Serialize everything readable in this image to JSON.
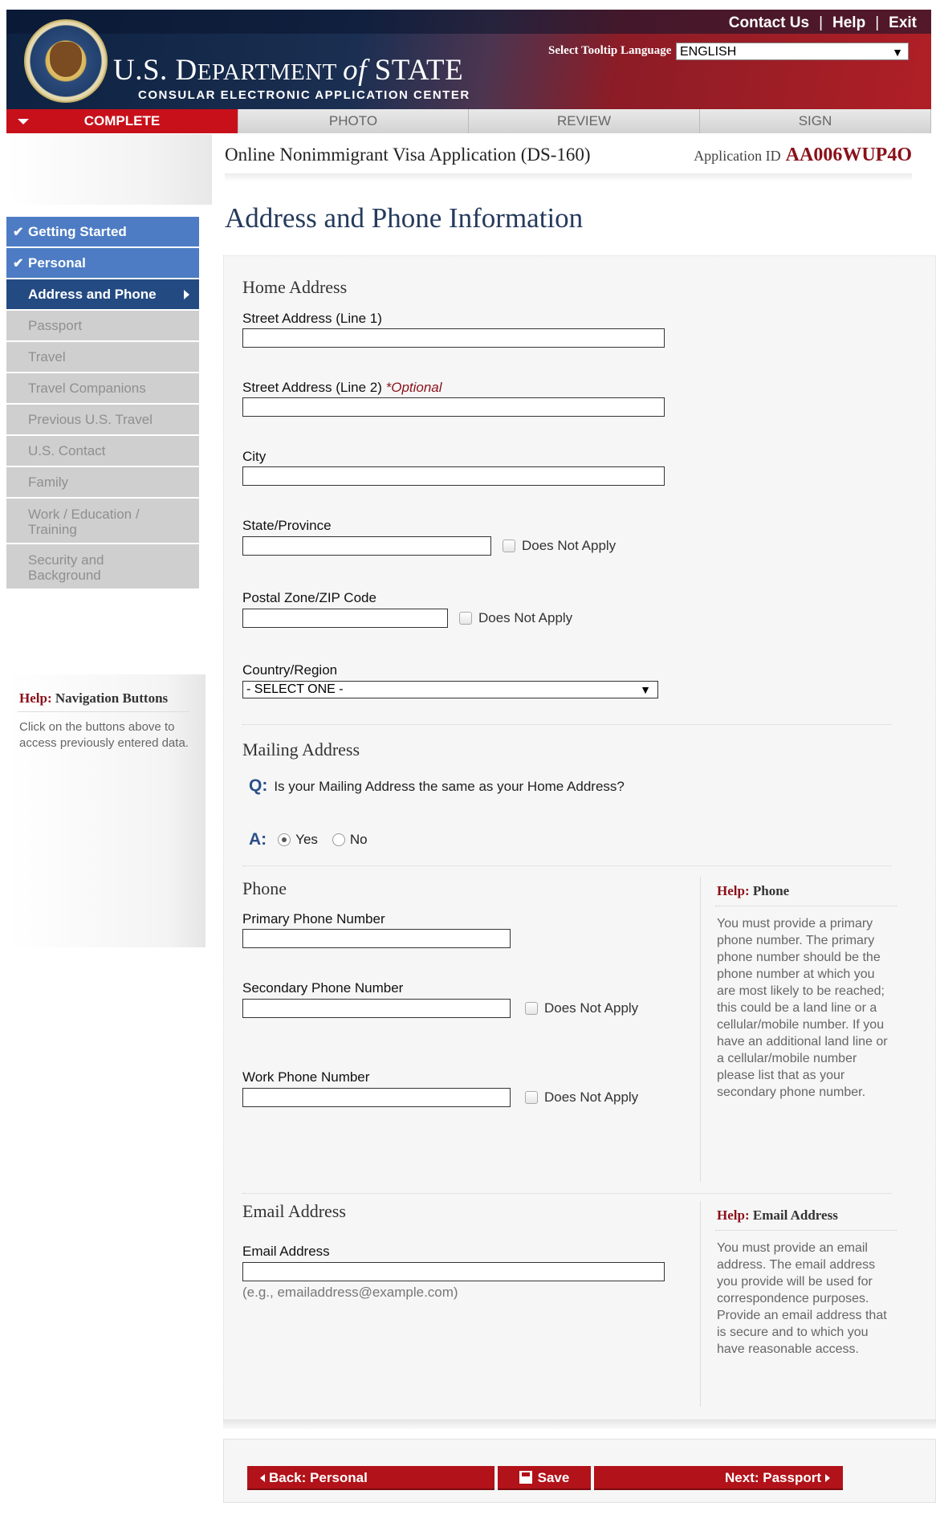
{
  "header": {
    "links": [
      "Contact Us",
      "Help",
      "Exit"
    ],
    "separator": "|",
    "dept_title_prefix": "U.S. D",
    "dept_title_mid": "EPARTMENT ",
    "dept_title_of": "of",
    "dept_title_state": " STATE",
    "subtitle": "CONSULAR ELECTRONIC APPLICATION CENTER",
    "tooltip_label": "Select Tooltip Language",
    "language": "ENGLISH"
  },
  "tabs": [
    "COMPLETE",
    "PHOTO",
    "REVIEW",
    "SIGN"
  ],
  "app": {
    "title": "Online Nonimmigrant Visa Application (DS-160)",
    "id_label": "Application ID",
    "id_value": "AA006WUP4O"
  },
  "page_title": "Address and Phone Information",
  "sidebar": {
    "items": [
      {
        "label": "Getting Started",
        "state": "done"
      },
      {
        "label": "Personal",
        "state": "done"
      },
      {
        "label": "Address and Phone",
        "state": "current"
      },
      {
        "label": "Passport",
        "state": "pending"
      },
      {
        "label": "Travel",
        "state": "pending"
      },
      {
        "label": "Travel Companions",
        "state": "pending"
      },
      {
        "label": "Previous U.S. Travel",
        "state": "pending"
      },
      {
        "label": "U.S. Contact",
        "state": "pending"
      },
      {
        "label": "Family",
        "state": "pending"
      },
      {
        "label": "Work / Education / Training",
        "state": "pending"
      },
      {
        "label": "Security and Background",
        "state": "pending"
      }
    ],
    "help_prefix": "Help:",
    "help_title": " Navigation Buttons",
    "help_text": "Click on the buttons above to access previously entered data."
  },
  "home": {
    "section": "Home Address",
    "street1_label": "Street Address (Line 1)",
    "street1_value": "",
    "street2_label": "Street Address (Line 2)",
    "street2_optional": "*Optional",
    "street2_value": "",
    "city_label": "City",
    "city_value": "",
    "state_label": "State/Province",
    "state_value": "",
    "postal_label": "Postal Zone/ZIP Code",
    "postal_value": "",
    "does_not_apply": "Does Not Apply",
    "country_label": "Country/Region",
    "country_value": "- SELECT ONE -"
  },
  "mailing": {
    "section": "Mailing Address",
    "q_prefix": "Q:",
    "question": "Is your Mailing Address the same as your Home Address?",
    "a_prefix": "A:",
    "yes": "Yes",
    "no": "No",
    "selected": "Yes"
  },
  "phone": {
    "section": "Phone",
    "primary_label": "Primary Phone Number",
    "primary_value": "",
    "secondary_label": "Secondary Phone Number",
    "secondary_value": "",
    "work_label": "Work Phone Number",
    "work_value": "",
    "does_not_apply": "Does Not Apply",
    "help_prefix": "Help:",
    "help_title": " Phone",
    "help_text": "You must provide a primary phone number. The primary phone number should be the phone number at which you are most likely to be reached; this could be a land line or a cellular/mobile number. If you have an additional land line or a cellular/mobile number please list that as your secondary phone number."
  },
  "email": {
    "section": "Email Address",
    "label": "Email Address",
    "value": "",
    "example": "(e.g., emailaddress@example.com)",
    "help_prefix": "Help:",
    "help_title": " Email Address",
    "help_text": "You must provide an email address. The email address you provide will be used for correspondence purposes. Provide an email address that is secure and to which you have reasonable access."
  },
  "buttons": {
    "back": "Back: Personal",
    "save": "Save",
    "next": "Next: Passport"
  },
  "colors": {
    "accent_red": "#b21219",
    "nav_done": "#4d7cc4",
    "nav_current": "#244a82",
    "nav_pending": "#cfcfcf"
  }
}
